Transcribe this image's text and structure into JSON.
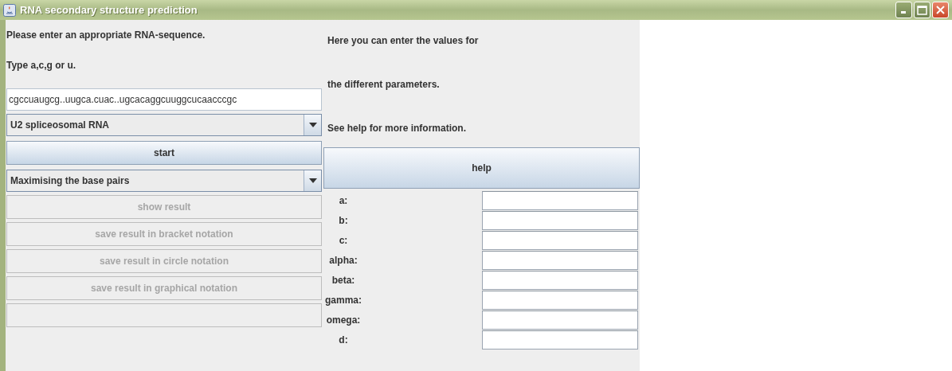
{
  "window": {
    "title": "RNA secondary structure prediction"
  },
  "sequence_panel": {
    "instructions": [
      "Please enter an appropriate RNA-sequence.",
      "Type a,c,g or u."
    ],
    "sequence": {
      "value": "cgccuaugcg..uugca.cuac..ugcacaggcuuggcucaacccgc"
    },
    "example_combo": {
      "value": "U2 spliceosomal RNA"
    },
    "start_button": {
      "label": "start",
      "disabled": false
    },
    "method_combo": {
      "value": "Maximising the base pairs"
    },
    "result_buttons": [
      {
        "label": "show result",
        "disabled": true
      },
      {
        "label": "save result in bracket notation",
        "disabled": true
      },
      {
        "label": "save result in circle notation",
        "disabled": true
      },
      {
        "label": "save result in graphical notation",
        "disabled": true
      }
    ]
  },
  "parameter_panel": {
    "instructions": [
      "Here you can enter the values for",
      "the different parameters.",
      "See help for more information."
    ],
    "help_button": {
      "label": "help",
      "disabled": false
    },
    "parameters": [
      {
        "label": "a:"
      },
      {
        "label": "b:"
      },
      {
        "label": "c:"
      },
      {
        "label": "alpha:"
      },
      {
        "label": "beta:"
      },
      {
        "label": "gamma:"
      },
      {
        "label": "omega:"
      },
      {
        "label": "d:"
      }
    ]
  }
}
